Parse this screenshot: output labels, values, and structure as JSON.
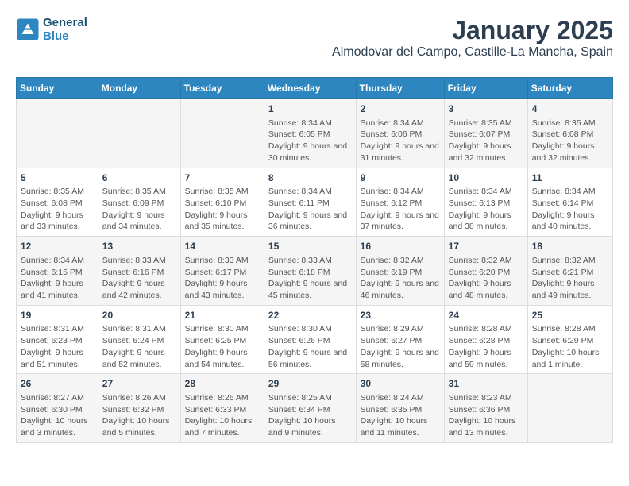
{
  "header": {
    "logo_line1": "General",
    "logo_line2": "Blue",
    "month": "January 2025",
    "location": "Almodovar del Campo, Castille-La Mancha, Spain"
  },
  "days_of_week": [
    "Sunday",
    "Monday",
    "Tuesday",
    "Wednesday",
    "Thursday",
    "Friday",
    "Saturday"
  ],
  "weeks": [
    [
      {
        "day": "",
        "info": ""
      },
      {
        "day": "",
        "info": ""
      },
      {
        "day": "",
        "info": ""
      },
      {
        "day": "1",
        "info": "Sunrise: 8:34 AM\nSunset: 6:05 PM\nDaylight: 9 hours and 30 minutes."
      },
      {
        "day": "2",
        "info": "Sunrise: 8:34 AM\nSunset: 6:06 PM\nDaylight: 9 hours and 31 minutes."
      },
      {
        "day": "3",
        "info": "Sunrise: 8:35 AM\nSunset: 6:07 PM\nDaylight: 9 hours and 32 minutes."
      },
      {
        "day": "4",
        "info": "Sunrise: 8:35 AM\nSunset: 6:08 PM\nDaylight: 9 hours and 32 minutes."
      }
    ],
    [
      {
        "day": "5",
        "info": "Sunrise: 8:35 AM\nSunset: 6:08 PM\nDaylight: 9 hours and 33 minutes."
      },
      {
        "day": "6",
        "info": "Sunrise: 8:35 AM\nSunset: 6:09 PM\nDaylight: 9 hours and 34 minutes."
      },
      {
        "day": "7",
        "info": "Sunrise: 8:35 AM\nSunset: 6:10 PM\nDaylight: 9 hours and 35 minutes."
      },
      {
        "day": "8",
        "info": "Sunrise: 8:34 AM\nSunset: 6:11 PM\nDaylight: 9 hours and 36 minutes."
      },
      {
        "day": "9",
        "info": "Sunrise: 8:34 AM\nSunset: 6:12 PM\nDaylight: 9 hours and 37 minutes."
      },
      {
        "day": "10",
        "info": "Sunrise: 8:34 AM\nSunset: 6:13 PM\nDaylight: 9 hours and 38 minutes."
      },
      {
        "day": "11",
        "info": "Sunrise: 8:34 AM\nSunset: 6:14 PM\nDaylight: 9 hours and 40 minutes."
      }
    ],
    [
      {
        "day": "12",
        "info": "Sunrise: 8:34 AM\nSunset: 6:15 PM\nDaylight: 9 hours and 41 minutes."
      },
      {
        "day": "13",
        "info": "Sunrise: 8:33 AM\nSunset: 6:16 PM\nDaylight: 9 hours and 42 minutes."
      },
      {
        "day": "14",
        "info": "Sunrise: 8:33 AM\nSunset: 6:17 PM\nDaylight: 9 hours and 43 minutes."
      },
      {
        "day": "15",
        "info": "Sunrise: 8:33 AM\nSunset: 6:18 PM\nDaylight: 9 hours and 45 minutes."
      },
      {
        "day": "16",
        "info": "Sunrise: 8:32 AM\nSunset: 6:19 PM\nDaylight: 9 hours and 46 minutes."
      },
      {
        "day": "17",
        "info": "Sunrise: 8:32 AM\nSunset: 6:20 PM\nDaylight: 9 hours and 48 minutes."
      },
      {
        "day": "18",
        "info": "Sunrise: 8:32 AM\nSunset: 6:21 PM\nDaylight: 9 hours and 49 minutes."
      }
    ],
    [
      {
        "day": "19",
        "info": "Sunrise: 8:31 AM\nSunset: 6:23 PM\nDaylight: 9 hours and 51 minutes."
      },
      {
        "day": "20",
        "info": "Sunrise: 8:31 AM\nSunset: 6:24 PM\nDaylight: 9 hours and 52 minutes."
      },
      {
        "day": "21",
        "info": "Sunrise: 8:30 AM\nSunset: 6:25 PM\nDaylight: 9 hours and 54 minutes."
      },
      {
        "day": "22",
        "info": "Sunrise: 8:30 AM\nSunset: 6:26 PM\nDaylight: 9 hours and 56 minutes."
      },
      {
        "day": "23",
        "info": "Sunrise: 8:29 AM\nSunset: 6:27 PM\nDaylight: 9 hours and 58 minutes."
      },
      {
        "day": "24",
        "info": "Sunrise: 8:28 AM\nSunset: 6:28 PM\nDaylight: 9 hours and 59 minutes."
      },
      {
        "day": "25",
        "info": "Sunrise: 8:28 AM\nSunset: 6:29 PM\nDaylight: 10 hours and 1 minute."
      }
    ],
    [
      {
        "day": "26",
        "info": "Sunrise: 8:27 AM\nSunset: 6:30 PM\nDaylight: 10 hours and 3 minutes."
      },
      {
        "day": "27",
        "info": "Sunrise: 8:26 AM\nSunset: 6:32 PM\nDaylight: 10 hours and 5 minutes."
      },
      {
        "day": "28",
        "info": "Sunrise: 8:26 AM\nSunset: 6:33 PM\nDaylight: 10 hours and 7 minutes."
      },
      {
        "day": "29",
        "info": "Sunrise: 8:25 AM\nSunset: 6:34 PM\nDaylight: 10 hours and 9 minutes."
      },
      {
        "day": "30",
        "info": "Sunrise: 8:24 AM\nSunset: 6:35 PM\nDaylight: 10 hours and 11 minutes."
      },
      {
        "day": "31",
        "info": "Sunrise: 8:23 AM\nSunset: 6:36 PM\nDaylight: 10 hours and 13 minutes."
      },
      {
        "day": "",
        "info": ""
      }
    ]
  ]
}
